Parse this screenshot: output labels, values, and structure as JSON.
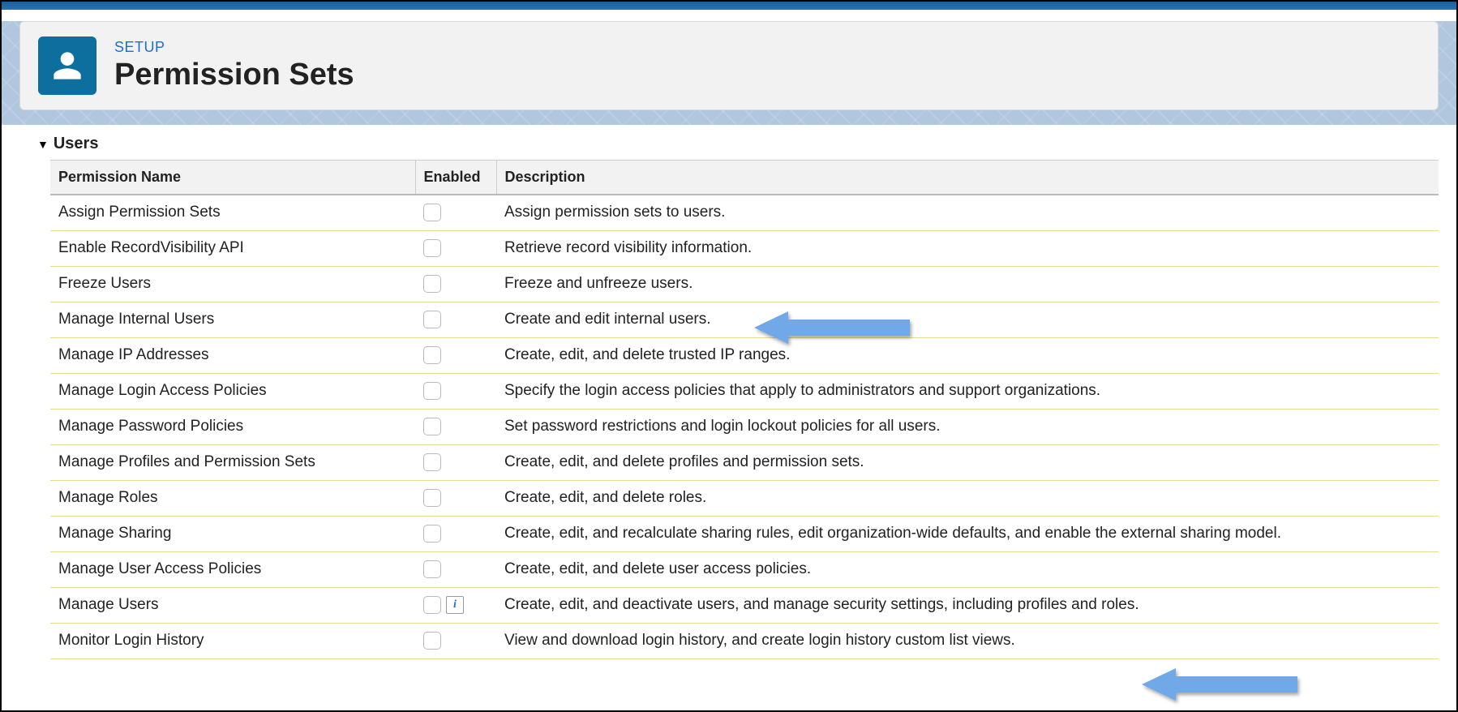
{
  "header": {
    "eyebrow": "SETUP",
    "title": "Permission Sets"
  },
  "section": {
    "title": "Users"
  },
  "table": {
    "columns": {
      "name": "Permission Name",
      "enabled": "Enabled",
      "description": "Description"
    },
    "rows": [
      {
        "name": "Assign Permission Sets",
        "enabled": false,
        "info": false,
        "description": "Assign permission sets to users."
      },
      {
        "name": "Enable RecordVisibility API",
        "enabled": false,
        "info": false,
        "description": "Retrieve record visibility information."
      },
      {
        "name": "Freeze Users",
        "enabled": false,
        "info": false,
        "description": "Freeze and unfreeze users."
      },
      {
        "name": "Manage Internal Users",
        "enabled": false,
        "info": false,
        "description": "Create and edit internal users."
      },
      {
        "name": "Manage IP Addresses",
        "enabled": false,
        "info": false,
        "description": "Create, edit, and delete trusted IP ranges."
      },
      {
        "name": "Manage Login Access Policies",
        "enabled": false,
        "info": false,
        "description": "Specify the login access policies that apply to administrators and support organizations."
      },
      {
        "name": "Manage Password Policies",
        "enabled": false,
        "info": false,
        "description": "Set password restrictions and login lockout policies for all users."
      },
      {
        "name": "Manage Profiles and Permission Sets",
        "enabled": false,
        "info": false,
        "description": "Create, edit, and delete profiles and permission sets."
      },
      {
        "name": "Manage Roles",
        "enabled": false,
        "info": false,
        "description": "Create, edit, and delete roles."
      },
      {
        "name": "Manage Sharing",
        "enabled": false,
        "info": false,
        "description": "Create, edit, and recalculate sharing rules, edit organization-wide defaults, and enable the external sharing model."
      },
      {
        "name": "Manage User Access Policies",
        "enabled": false,
        "info": false,
        "description": "Create, edit, and delete user access policies."
      },
      {
        "name": "Manage Users",
        "enabled": false,
        "info": true,
        "description": "Create, edit, and deactivate users, and manage security settings, including profiles and roles."
      },
      {
        "name": "Monitor Login History",
        "enabled": false,
        "info": false,
        "description": "View and download login history, and create login history custom list views."
      }
    ]
  },
  "info_badge_label": "i",
  "annotations": {
    "arrow_color": "#6fa8e8"
  }
}
